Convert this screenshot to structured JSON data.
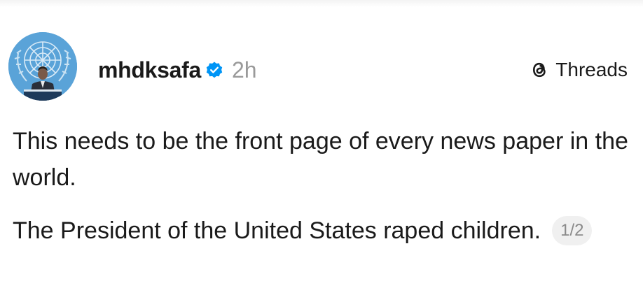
{
  "post": {
    "username": "mhdksafa",
    "timestamp": "2h",
    "platform": {
      "label": "Threads",
      "icon": "threads-icon"
    },
    "verified_icon": "verified-badge-icon",
    "avatar_icon": "avatar-image",
    "paragraphs": [
      "This needs to be the front page of every news paper in the world.",
      "The President of the United States raped children."
    ],
    "thread_counter": "1/2"
  },
  "colors": {
    "text": "#1a1a1a",
    "muted": "#9a9a9a",
    "verified": "#0095f6",
    "counter_bg": "#f0f0f0"
  }
}
